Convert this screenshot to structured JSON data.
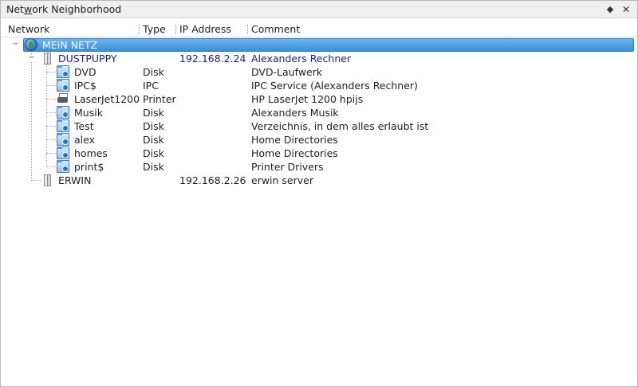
{
  "window": {
    "title_pre": "Net",
    "title_mnemonic": "w",
    "title_post": "ork Neighborhood",
    "float_glyph": "◆",
    "close_glyph": "✕"
  },
  "columns": {
    "network": "Network",
    "type": "Type",
    "ip": "IP Address",
    "comment": "Comment"
  },
  "tree": {
    "root": {
      "name": "MEIN NETZ",
      "expander": "−"
    },
    "hosts": [
      {
        "name": "DUSTPUPPY",
        "ip": "192.168.2.24",
        "comment": "Alexanders Rechner",
        "expander": "−",
        "shares": [
          {
            "name": "DVD",
            "type": "Disk",
            "comment": "DVD-Laufwerk",
            "icon": "share-folder-icon"
          },
          {
            "name": "IPC$",
            "type": "IPC",
            "comment": "IPC Service (Alexanders Rechner)",
            "icon": "share-folder-icon"
          },
          {
            "name": "LaserJet1200",
            "type": "Printer",
            "comment": "HP LaserJet 1200 hpijs",
            "icon": "printer-icon"
          },
          {
            "name": "Musik",
            "type": "Disk",
            "comment": "Alexanders Musik",
            "icon": "share-folder-icon"
          },
          {
            "name": "Test",
            "type": "Disk",
            "comment": "Verzeichnis, in dem alles erlaubt ist",
            "icon": "share-folder-icon"
          },
          {
            "name": "alex",
            "type": "Disk",
            "comment": "Home Directories",
            "icon": "share-folder-icon"
          },
          {
            "name": "homes",
            "type": "Disk",
            "comment": "Home Directories",
            "icon": "share-folder-icon"
          },
          {
            "name": "print$",
            "type": "Disk",
            "comment": "Printer Drivers",
            "icon": "share-folder-icon"
          }
        ]
      },
      {
        "name": "ERWIN",
        "ip": "192.168.2.26",
        "comment": "erwin server",
        "shares": []
      }
    ]
  },
  "colors": {
    "selection": "#3c8fd6",
    "active_host_text": "#1a1a8c"
  }
}
